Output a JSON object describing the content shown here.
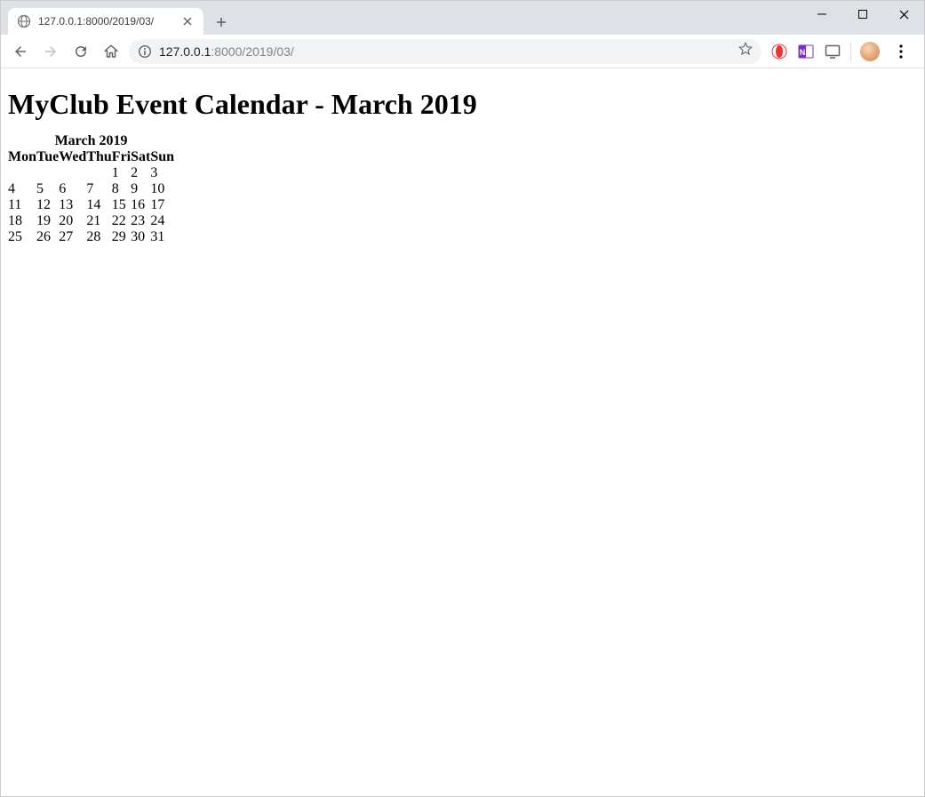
{
  "browser": {
    "tab_title": "127.0.0.1:8000/2019/03/",
    "url_host": "127.0.0.1",
    "url_port_path": ":8000/2019/03/"
  },
  "page": {
    "heading": "MyClub Event Calendar - March 2019",
    "calendar": {
      "caption": "March 2019",
      "weekdays": [
        "Mon",
        "Tue",
        "Wed",
        "Thu",
        "Fri",
        "Sat",
        "Sun"
      ],
      "rows": [
        [
          "",
          "",
          "",
          "",
          "1",
          "2",
          "3"
        ],
        [
          "4",
          "5",
          "6",
          "7",
          "8",
          "9",
          "10"
        ],
        [
          "11",
          "12",
          "13",
          "14",
          "15",
          "16",
          "17"
        ],
        [
          "18",
          "19",
          "20",
          "21",
          "22",
          "23",
          "24"
        ],
        [
          "25",
          "26",
          "27",
          "28",
          "29",
          "30",
          "31"
        ]
      ]
    }
  }
}
